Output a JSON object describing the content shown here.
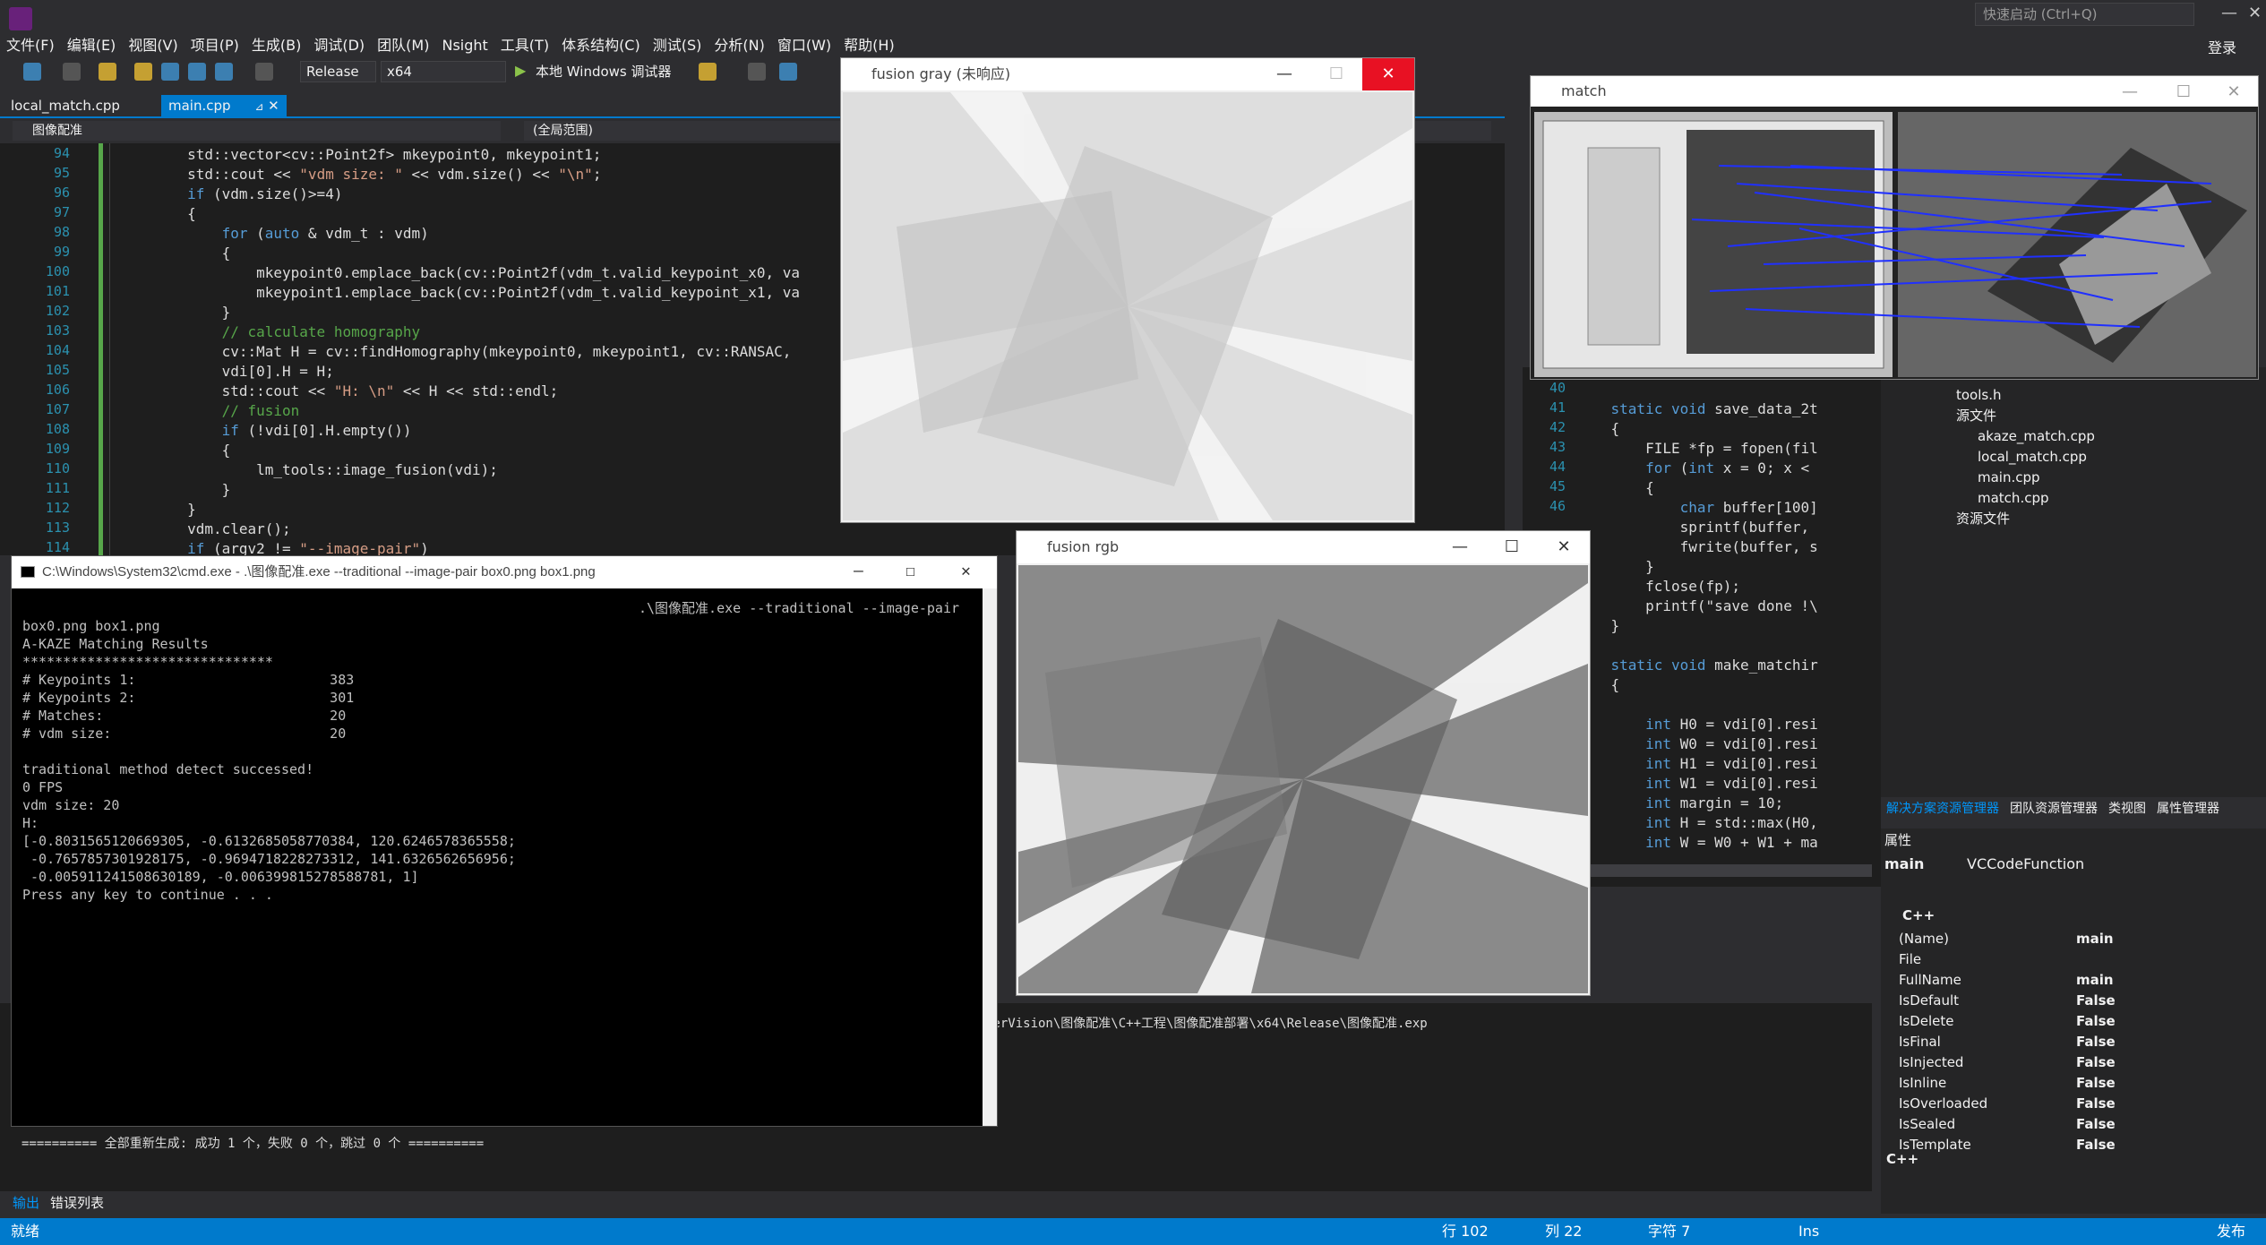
{
  "titlebar": {
    "quick_launch": "快速启动 (Ctrl+Q)",
    "signin": "登录"
  },
  "menu": [
    "文件(F)",
    "编辑(E)",
    "视图(V)",
    "项目(P)",
    "生成(B)",
    "调试(D)",
    "团队(M)",
    "Nsight",
    "工具(T)",
    "体系结构(C)",
    "测试(S)",
    "分析(N)",
    "窗口(W)",
    "帮助(H)"
  ],
  "toolbar": {
    "config": "Release",
    "platform": "x64",
    "run_label": "本地 Windows 调试器"
  },
  "tabs": {
    "tab1": "local_match.cpp",
    "tab2": "main.cpp"
  },
  "navbar": {
    "project": "图像配准",
    "scope": "(全局范围)"
  },
  "editor_lines": [
    {
      "n": "94",
      "t": "        std::vector<cv::Point2f> mkeypoint0, mkeypoint1;"
    },
    {
      "n": "95",
      "t": "        std::cout << \"vdm size: \" << vdm.size() << \"\\n\";"
    },
    {
      "n": "96",
      "t": "        if (vdm.size()>=4)"
    },
    {
      "n": "97",
      "t": "        {"
    },
    {
      "n": "98",
      "t": "            for (auto & vdm_t : vdm)"
    },
    {
      "n": "99",
      "t": "            {"
    },
    {
      "n": "100",
      "t": "                mkeypoint0.emplace_back(cv::Point2f(vdm_t.valid_keypoint_x0, va"
    },
    {
      "n": "101",
      "t": "                mkeypoint1.emplace_back(cv::Point2f(vdm_t.valid_keypoint_x1, va"
    },
    {
      "n": "102",
      "t": "            }"
    },
    {
      "n": "103",
      "t": "            // calculate homography"
    },
    {
      "n": "104",
      "t": "            cv::Mat H = cv::findHomography(mkeypoint0, mkeypoint1, cv::RANSAC,"
    },
    {
      "n": "105",
      "t": "            vdi[0].H = H;"
    },
    {
      "n": "106",
      "t": "            std::cout << \"H: \\n\" << H << std::endl;"
    },
    {
      "n": "107",
      "t": "            // fusion"
    },
    {
      "n": "108",
      "t": "            if (!vdi[0].H.empty())"
    },
    {
      "n": "109",
      "t": "            {"
    },
    {
      "n": "110",
      "t": "                lm_tools::image_fusion(vdi);"
    },
    {
      "n": "111",
      "t": "            }"
    },
    {
      "n": "112",
      "t": "        }"
    },
    {
      "n": "113",
      "t": "        vdm.clear();"
    },
    {
      "n": "114",
      "t": "        if (argv2 != \"--image-pair\")"
    }
  ],
  "right_editor_lines": [
    {
      "n": "40",
      "t": ""
    },
    {
      "n": "41",
      "t": "    static void save_data_2t"
    },
    {
      "n": "42",
      "t": "    {"
    },
    {
      "n": "43",
      "t": "        FILE *fp = fopen(fil"
    },
    {
      "n": "44",
      "t": "        for (int x = 0; x <"
    },
    {
      "n": "45",
      "t": "        {"
    },
    {
      "n": "46",
      "t": "            char buffer[100]"
    },
    {
      "n": "",
      "t": "            sprintf(buffer,"
    },
    {
      "n": "",
      "t": "            fwrite(buffer, s"
    },
    {
      "n": "",
      "t": "        }"
    },
    {
      "n": "",
      "t": "        fclose(fp);"
    },
    {
      "n": "",
      "t": "        printf(\"save done !\\"
    },
    {
      "n": "",
      "t": "    }"
    },
    {
      "n": "",
      "t": ""
    },
    {
      "n": "",
      "t": "    static void make_matchir"
    },
    {
      "n": "",
      "t": "    {"
    },
    {
      "n": "",
      "t": ""
    },
    {
      "n": "",
      "t": "        int H0 = vdi[0].resi"
    },
    {
      "n": "",
      "t": "        int W0 = vdi[0].resi"
    },
    {
      "n": "",
      "t": "        int H1 = vdi[0].resi"
    },
    {
      "n": "",
      "t": "        int W1 = vdi[0].resi"
    },
    {
      "n": "",
      "t": "        int margin = 10;"
    },
    {
      "n": "",
      "t": "        int H = std::max(H0,"
    },
    {
      "n": "",
      "t": "        int W = W0 + W1 + ma"
    }
  ],
  "solution": {
    "items": [
      "tools.h",
      "源文件",
      "akaze_match.cpp",
      "local_match.cpp",
      "main.cpp",
      "match.cpp",
      "资源文件"
    ],
    "tabs": [
      "解决方案资源管理器",
      "团队资源管理器",
      "类视图",
      "属性管理器"
    ]
  },
  "props": {
    "title": "属性",
    "subject": "main",
    "subject_type": "VCCodeFunction",
    "category": "C++",
    "footer": "C++",
    "rows": [
      {
        "k": "(Name)",
        "v": "main"
      },
      {
        "k": "File",
        "v": ""
      },
      {
        "k": "FullName",
        "v": "main"
      },
      {
        "k": "IsDefault",
        "v": "False"
      },
      {
        "k": "IsDelete",
        "v": "False"
      },
      {
        "k": "IsFinal",
        "v": "False"
      },
      {
        "k": "IsInjected",
        "v": "False"
      },
      {
        "k": "IsInline",
        "v": "False"
      },
      {
        "k": "IsOverloaded",
        "v": "False"
      },
      {
        "k": "IsSealed",
        "v": "False"
      },
      {
        "k": "IsTemplate",
        "v": "False"
      }
    ]
  },
  "output": {
    "path_line": "terVision\\图像配准\\C++工程\\图像配准部署\\x64\\Release\\图像配准.exp",
    "build_line": "========== 全部重新生成: 成功 1 个，失败 0 个，跳过 0 个 =========="
  },
  "output_tabs": {
    "tab1": "输出",
    "tab2": "错误列表"
  },
  "status": {
    "ready": "就绪",
    "line": "行 102",
    "col": "列 22",
    "char": "字符 7",
    "ins": "Ins",
    "publish": "发布"
  },
  "windows": {
    "fusion_gray": "fusion gray (未响应)",
    "fusion_rgb": "fusion rgb",
    "match": "match",
    "cmd": "C:\\Windows\\System32\\cmd.exe - .\\图像配准.exe  --traditional --image-pair box0.png box1.png"
  },
  "cmd_lines": [
    ".\\图像配准.exe --traditional --image-pair",
    "box0.png box1.png",
    "A-KAZE Matching Results",
    "*******************************",
    "# Keypoints 1:                        383",
    "# Keypoints 2:                        301",
    "# Matches:                            20",
    "# vdm size:                           20",
    "",
    "traditional method detect successed!",
    "0 FPS",
    "vdm size: 20",
    "H:",
    "[-0.8031565120669305, -0.6132685058770384, 120.6246578365558;",
    " -0.7657857301928175, -0.9694718228273312, 141.6326562656956;",
    " -0.005911241508630189, -0.006399815278588781, 1]",
    "Press any key to continue . . ."
  ]
}
